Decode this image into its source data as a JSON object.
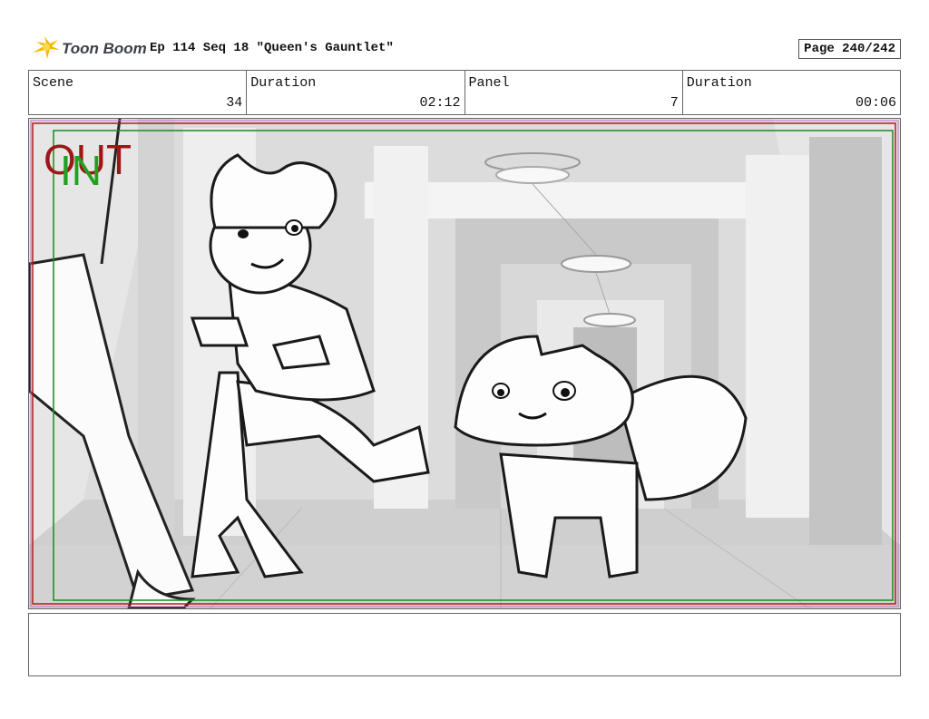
{
  "header": {
    "logo_text": "Toon Boom",
    "title": "Ep 114 Seq 18 \"Queen's Gauntlet\"",
    "page": "Page 240/242"
  },
  "info": {
    "scene_label": "Scene",
    "scene_value": "34",
    "duration_label": "Duration",
    "duration_value": "02:12",
    "panel_label": "Panel",
    "panel_value": "7",
    "panel_duration_label": "Duration",
    "panel_duration_value": "00:06"
  },
  "panel": {
    "out_label": "OUT",
    "in_label": "IN",
    "out_color": "#a01616",
    "in_color": "#22a022"
  },
  "notes": {
    "text": ""
  }
}
